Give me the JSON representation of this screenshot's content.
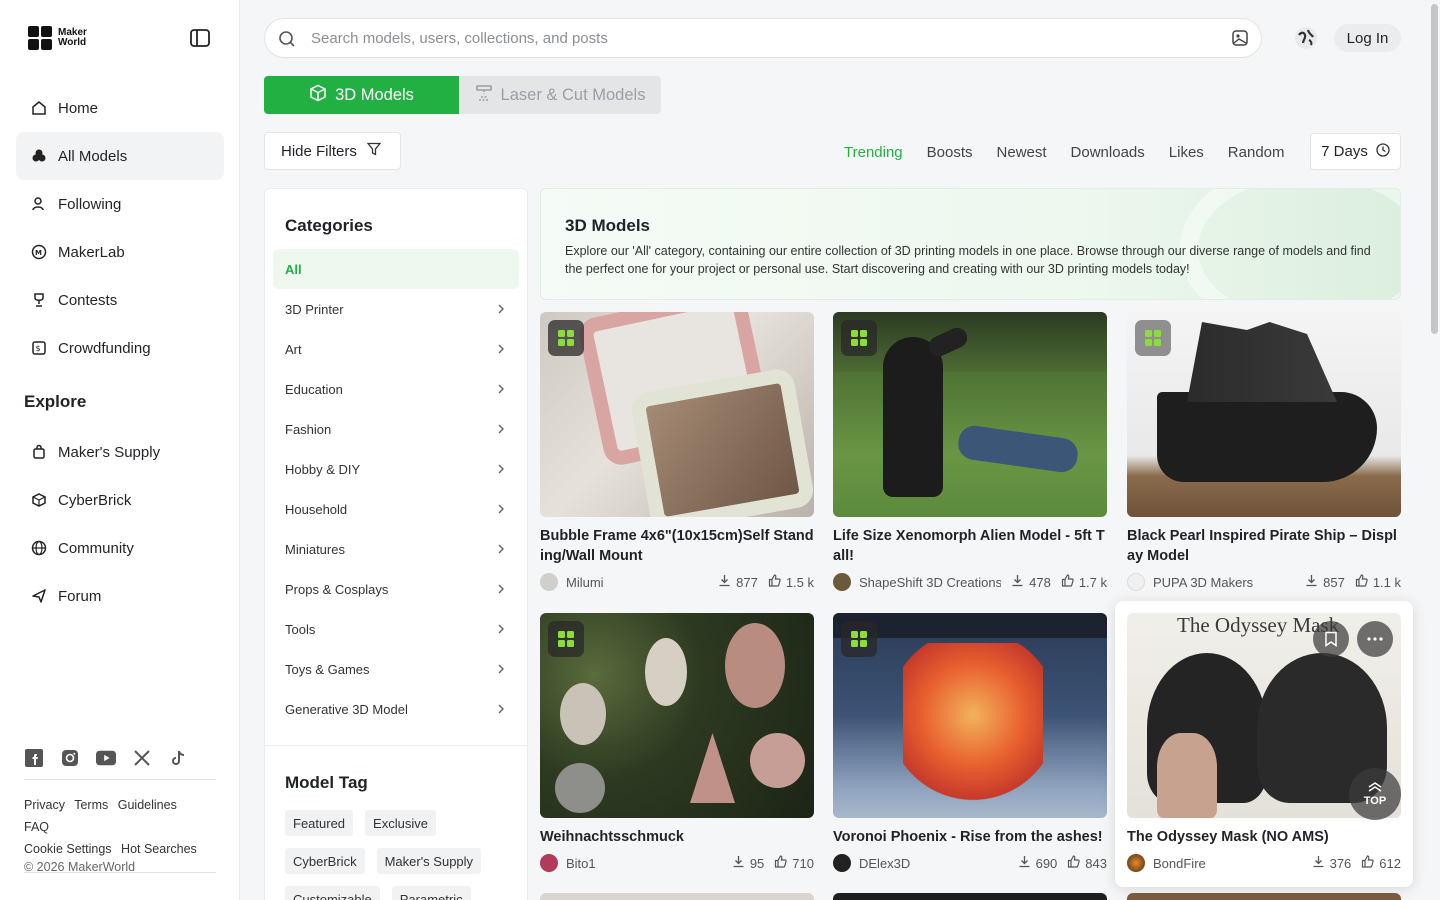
{
  "brand": {
    "logo_line1": "Maker",
    "logo_line2": "World"
  },
  "sidebar": {
    "items": [
      {
        "label": "Home",
        "icon": "home-icon"
      },
      {
        "label": "All Models",
        "icon": "models-icon",
        "active": true
      },
      {
        "label": "Following",
        "icon": "following-icon"
      },
      {
        "label": "MakerLab",
        "icon": "makerlab-icon"
      },
      {
        "label": "Contests",
        "icon": "trophy-icon"
      },
      {
        "label": "Crowdfunding",
        "icon": "crowdfunding-icon"
      }
    ],
    "explore_title": "Explore",
    "explore_items": [
      {
        "label": "Maker's Supply",
        "icon": "bag-icon"
      },
      {
        "label": "CyberBrick",
        "icon": "cyberbrick-icon"
      },
      {
        "label": "Community",
        "icon": "globe-icon"
      },
      {
        "label": "Forum",
        "icon": "send-icon"
      }
    ],
    "social": [
      "facebook-icon",
      "instagram-icon",
      "youtube-icon",
      "x-icon",
      "tiktok-icon"
    ],
    "footer_links": [
      "Privacy",
      "Terms",
      "Guidelines",
      "FAQ",
      "Cookie Settings",
      "Hot Searches"
    ],
    "copyright": "© 2026 MakerWorld"
  },
  "search": {
    "placeholder": "Search models, users, collections, and posts"
  },
  "header": {
    "login_label": "Log In"
  },
  "tabs": [
    {
      "label": "3D Models",
      "active": true
    },
    {
      "label": "Laser & Cut Models",
      "active": false
    }
  ],
  "filters": {
    "hide_label": "Hide Filters",
    "sorts": [
      "Trending",
      "Boosts",
      "Newest",
      "Downloads",
      "Likes",
      "Random"
    ],
    "active_sort": "Trending",
    "period": "7 Days"
  },
  "categories": {
    "title": "Categories",
    "items": [
      "All",
      "3D Printer",
      "Art",
      "Education",
      "Fashion",
      "Hobby & DIY",
      "Household",
      "Miniatures",
      "Props & Cosplays",
      "Tools",
      "Toys & Games",
      "Generative 3D Model"
    ],
    "tag_title": "Model Tag",
    "tags": [
      "Featured",
      "Exclusive",
      "CyberBrick",
      "Maker's Supply",
      "Customizable",
      "Parametric"
    ]
  },
  "banner": {
    "title": "3D Models",
    "text": "Explore our 'All' category, containing our entire collection of 3D printing models in one place. Browse through our diverse range of models and find the perfect one for your project or personal use. Start discovering and creating with our 3D printing models today!"
  },
  "cards": [
    {
      "title": "Bubble Frame 4x6\"(10x15cm)Self Standing/Wall Mount",
      "author": "Milumi",
      "downloads": "877",
      "likes": "1.5 k"
    },
    {
      "title": "Life Size Xenomorph Alien Model - 5ft Tall!",
      "author": "ShapeShift 3D Creations",
      "downloads": "478",
      "likes": "1.7 k"
    },
    {
      "title": "Black Pearl Inspired Pirate Ship – Display Model",
      "author": "PUPA 3D Makers",
      "downloads": "857",
      "likes": "1.1 k"
    },
    {
      "title": "Weihnachtsschmuck",
      "author": "Bito1",
      "downloads": "95",
      "likes": "710"
    },
    {
      "title": "Voronoi Phoenix - Rise from the ashes!",
      "author": "DElex3D",
      "downloads": "690",
      "likes": "843"
    },
    {
      "title": "The Odyssey Mask (NO AMS)",
      "author": "BondFire",
      "downloads": "376",
      "likes": "612",
      "image_caption": "The Odyssey Mask"
    }
  ],
  "back_to_top": "TOP",
  "colors": {
    "accent": "#22b043",
    "sidebar_active": "#f2f3f4",
    "text": "#1f2328"
  }
}
